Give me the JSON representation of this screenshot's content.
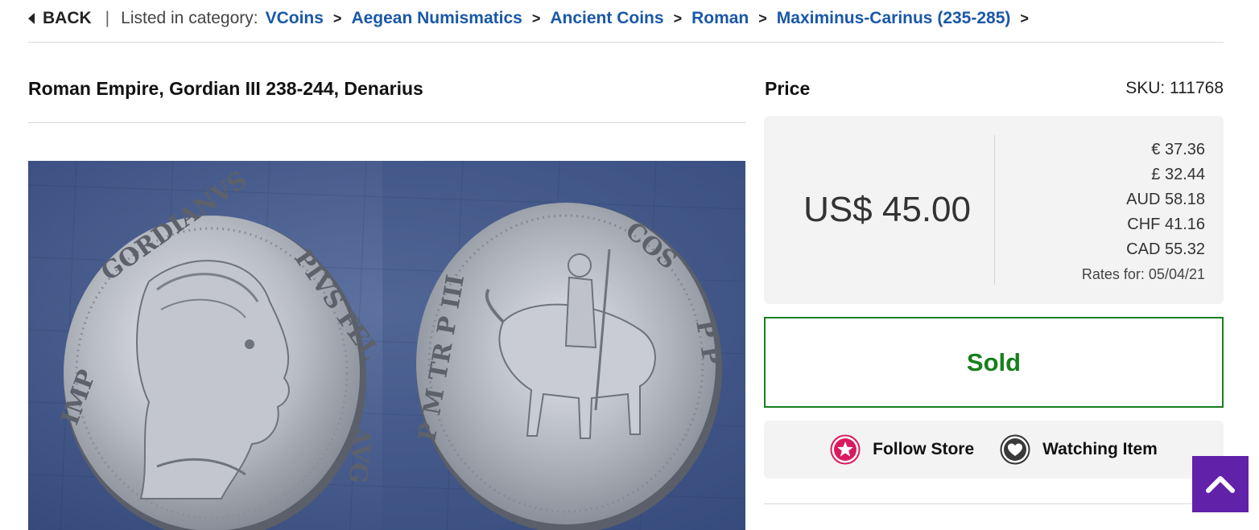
{
  "breadcrumb": {
    "back_label": "BACK",
    "pipe": "|",
    "listed_label": "Listed in category:",
    "separator": ">",
    "items": [
      "VCoins",
      "Aegean Numismatics",
      "Ancient Coins",
      "Roman",
      "Maximinus-Carinus (235-285)"
    ]
  },
  "listing": {
    "title": "Roman Empire, Gordian III 238-244, Denarius"
  },
  "pricing": {
    "label": "Price",
    "sku": "SKU: 111768",
    "main_price": "US$ 45.00",
    "rates": [
      "€ 37.36",
      "£ 32.44",
      "AUD 58.18",
      "CHF 41.16",
      "CAD 55.32"
    ],
    "rates_date": "Rates for: 05/04/21"
  },
  "status": {
    "sold_label": "Sold",
    "sold_color": "#17801c"
  },
  "actions": {
    "follow_label": "Follow Store",
    "follow_icon": "star-icon",
    "follow_color": "#d81b60",
    "watch_label": "Watching Item",
    "watch_icon": "heart-icon"
  },
  "colors": {
    "link": "#1a58a8",
    "scroll_top": "#6121a8",
    "photo_background": "#3f5580"
  }
}
